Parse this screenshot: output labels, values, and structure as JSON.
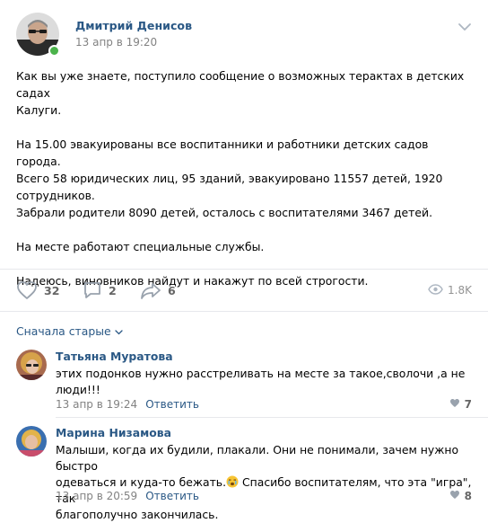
{
  "post": {
    "author": "Дмитрий Денисов",
    "time": "13 апр в 19:20",
    "paragraphs": [
      [
        "Как вы уже знаете, поступило сообщение о возможных терактах в детских садах",
        "Калуги."
      ],
      [
        "На 15.00 эвакуированы все воспитанники и работники детских садов города.",
        "Всего 58 юридических лиц, 95 зданий, эвакуировано 11557 детей, 1920",
        "сотрудников.",
        "Забрали родители 8090 детей, осталось с воспитателями 3467 детей."
      ],
      [
        "На месте работают специальные службы."
      ],
      [
        "Надеюсь, виновников найдут и накажут по всей строгости."
      ]
    ],
    "likes": "32",
    "comments": "2",
    "shares": "6",
    "views": "1.8K"
  },
  "comments_header": {
    "sort_label": "Сначала старые"
  },
  "comments": [
    {
      "author": "Татьяна Муратова",
      "lines": [
        "этих подонков нужно расстреливать на месте за такое,сволочи ,а не",
        "люди!!!"
      ],
      "time": "13 апр в 19:24",
      "reply_label": "Ответить",
      "likes": "7"
    },
    {
      "author": "Марина Низамова",
      "lines": [
        "Малыши, когда их будили, плакали. Они не понимали, зачем нужно быстро",
        "одеваться и куда-то бежать.",
        " Спасибо воспитателям, что эта \"игра\", так",
        "благополучно закончилась."
      ],
      "time": "13 апр в 20:59",
      "reply_label": "Ответить",
      "likes": "8"
    }
  ],
  "icons": {
    "like": "heart-icon",
    "comment": "speech-bubble-icon",
    "share": "share-arrow-icon",
    "views": "eye-icon",
    "menu": "chevron-down-icon",
    "emoji": "crying-face-emoji"
  },
  "colors": {
    "link": "#2a5885",
    "meta": "#828282",
    "online": "#4bb34b",
    "divider": "#e7e8ec"
  }
}
